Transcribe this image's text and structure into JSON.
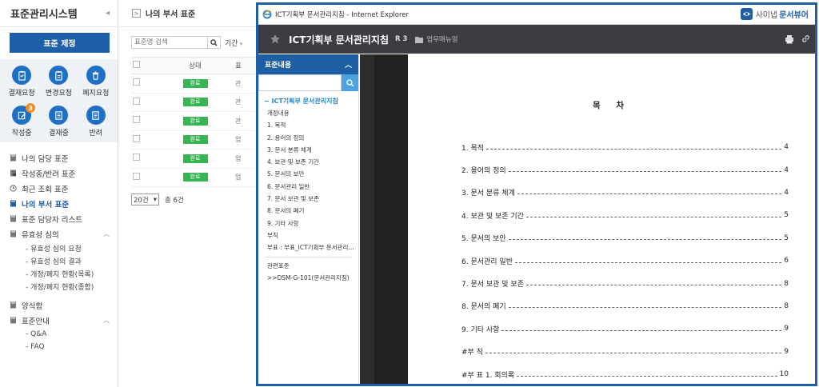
{
  "sidebar": {
    "app_title": "표준관리시스템",
    "new_standard_button": "표준 제정",
    "actions": [
      {
        "label": "결재요청",
        "icon": "clipboard-icon"
      },
      {
        "label": "변경요청",
        "icon": "clipboard-edit-icon"
      },
      {
        "label": "폐지요청",
        "icon": "trash-icon"
      },
      {
        "label": "작성중",
        "icon": "pencil-icon",
        "badge": "3"
      },
      {
        "label": "결재중",
        "icon": "list-icon"
      },
      {
        "label": "반려",
        "icon": "document-icon"
      }
    ],
    "menu": [
      {
        "label": "나의 담당 표준"
      },
      {
        "label": "작성중/반려 표준"
      },
      {
        "label": "최근 조회 표준"
      },
      {
        "label": "나의 부서 표준"
      },
      {
        "label": "표준 담당자 리스트"
      },
      {
        "label": "유효성 심의"
      }
    ],
    "validity_submenu": [
      "- 유효성 심의 요청",
      "- 유효성 심의 결과",
      "- 개정/폐지 현황(목록)",
      "- 개정/폐지 현황(종합)"
    ],
    "form_menu": "양식함",
    "guide_menu": "표준안내",
    "guide_submenu": [
      "- Q&A",
      "- FAQ"
    ]
  },
  "middle": {
    "breadcrumb": "나의 부서 표준",
    "back_glyph": ">",
    "search_placeholder": "표준명 검색",
    "period_label": "기간",
    "period_glyph": "▾",
    "columns": {
      "status": "상태",
      "standard": "표"
    },
    "rows": [
      {
        "status": "완료",
        "trunc": "관"
      },
      {
        "status": "완료",
        "trunc": "관"
      },
      {
        "status": "완료",
        "trunc": "관"
      },
      {
        "status": "완료",
        "trunc": "업"
      },
      {
        "status": "완료",
        "trunc": "업"
      },
      {
        "status": "완료",
        "trunc": "업"
      }
    ],
    "page_size": "20건",
    "total": "총 6건"
  },
  "ie_window": {
    "window_title": "ICT기획부 문서관리지침 - Internet Explorer",
    "brand_prefix": "사이냅",
    "brand_name": "문서뷰어",
    "doc_title": "ICT기획부 문서관리지침",
    "revision": "R 3",
    "category": "업무매뉴얼",
    "toc_panel_title": "표준내용",
    "toc_root": "ICT기획부 문서관리지침",
    "toc_items": [
      "개정내용",
      "1. 목적",
      "2. 용어의 정의",
      "3. 문서 분류 체계",
      "4. 보관 및 보존 기간",
      "5. 문서의 보안",
      "6. 문서관리 일반",
      "7. 문서 보관 및 보존",
      "8. 문서의 폐기",
      "9. 기타 사항",
      "부칙",
      "부표 : 부표_ICT기획부 문서관리지침"
    ],
    "related_title": "관련표준",
    "related_items": [
      ">>DSM-G-101(문서관리지침)"
    ],
    "page_heading": "목 차",
    "page_toc": [
      {
        "label": "1. 목적",
        "page": "4"
      },
      {
        "label": "2. 용어의 정의",
        "page": "4"
      },
      {
        "label": "3. 문서 분류 체계",
        "page": "4"
      },
      {
        "label": "4. 보관 및 보존 기간",
        "page": "5"
      },
      {
        "label": "5. 문서의 보안",
        "page": "5"
      },
      {
        "label": "6. 문서관리 일반",
        "page": "6"
      },
      {
        "label": "7. 문서 보관 및 보존",
        "page": "8"
      },
      {
        "label": "8. 문서의 폐기",
        "page": "8"
      },
      {
        "label": "9. 기타 사항",
        "page": "9"
      },
      {
        "label": "#부 칙",
        "page": "9"
      },
      {
        "label": "#부 표 1. 회의록",
        "page": "10"
      }
    ]
  },
  "colors": {
    "primary": "#1f5ea8",
    "icon_circle": "#1f6fc5",
    "status_green": "#36b553",
    "badge_orange": "#f28c1e",
    "viewer_bar": "#3b3d42",
    "toc_link": "#1f86c8"
  }
}
